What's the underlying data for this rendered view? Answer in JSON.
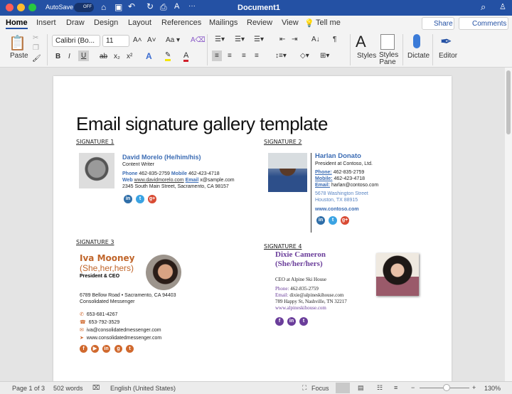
{
  "titlebar": {
    "autosave": "AutoSave",
    "toggle": "OFF",
    "title": "Document1",
    "more": "···"
  },
  "tabs": [
    "Home",
    "Insert",
    "Draw",
    "Design",
    "Layout",
    "References",
    "Mailings",
    "Review",
    "View",
    "Tell me"
  ],
  "share": "Share",
  "comments": "Comments",
  "ribbon": {
    "paste": "Paste",
    "font": "Calibri (Bo...",
    "size": "11",
    "styles": "Styles",
    "styles_pane": "Styles Pane",
    "dictate": "Dictate",
    "editor": "Editor"
  },
  "doc": {
    "title": "Email signature gallery template",
    "sig1": {
      "label": "SIGNATURE 1",
      "name": "David Morelo (He/him/his)",
      "role": "Content Writer",
      "phone_l": "Phone",
      "phone": "462-835-2759",
      "mobile_l": "Mobile",
      "mobile": "462-423-4718",
      "web_l": "Web",
      "web": "www.davidmorelo.com",
      "email_l": "Email",
      "email": "x@sample.com",
      "address": "2345 South Main Street, Sacramento, CA 98157"
    },
    "sig2": {
      "label": "SIGNATURE 2",
      "name": "Harlan Donato",
      "role": "President at Contoso, Ltd.",
      "phone_l": "Phone:",
      "phone": "462-835-2759",
      "mobile_l": "Mobile:",
      "mobile": "462-423-4718",
      "email_l": "Email:",
      "email": "harlan@contoso.com",
      "addr1": "5678 Washington Street",
      "addr2": "Houston, TX 88915",
      "web": "www.contoso.com"
    },
    "sig3": {
      "label": "SIGNATURE 3",
      "name": "Iva Mooney",
      "pronouns": "(She,her,hers)",
      "role": "President & CEO",
      "addr1": "6789 Bellow Road • Sacramento, CA 94403",
      "addr2": "Consolidated Messenger",
      "phone1": "653-681-4267",
      "phone2": "653-792-3529",
      "email": "iva@consolidatedmessenger.com",
      "web": "www.consolidatedmessenger.com"
    },
    "sig4": {
      "label": "SIGNATURE 4",
      "name": "Dixie Cameron",
      "pronouns": "(She/her/hers)",
      "role": "CEO at Alpine Ski House",
      "phone_l": "Phone:",
      "phone": "462-835-2759",
      "email_l": "Email:",
      "email": "dixie@alpineskihouse.com",
      "address": "789 Happy St, Nashville, TN 32217",
      "web": "www.alpineskihouse.com"
    }
  },
  "status": {
    "page": "Page 1 of 3",
    "words": "502 words",
    "language": "English (United States)",
    "focus": "Focus",
    "zoom": "130%"
  },
  "zoom_level": 130
}
